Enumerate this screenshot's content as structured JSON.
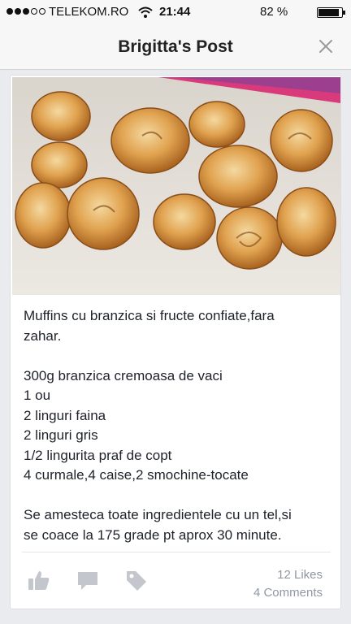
{
  "status_bar": {
    "carrier": "TELEKOM.RO",
    "time": "21:44",
    "battery": "82 %",
    "battery_level": 0.82,
    "icons": [
      "signal-icon",
      "wifi-icon",
      "battery-icon"
    ]
  },
  "nav": {
    "title": "Brigitta's Post",
    "close_icon": "close-icon"
  },
  "post": {
    "photo_icon": "muffins-photo",
    "title_lines": [
      "Muffins cu branzica si fructe confiate,fara",
      "zahar."
    ],
    "ingredients": [
      "300g branzica cremoasa de vaci",
      "1 ou",
      "2 linguri faina",
      "2 linguri gris",
      "1/2 lingurita praf de copt",
      "4 curmale,4 caise,2 smochine-tocate"
    ],
    "instructions_lines": [
      "Se amesteca toate ingredientele cu un tel,si",
      "se coace la 175 grade pt aprox 30 minute."
    ]
  },
  "footer": {
    "likes": "12 Likes",
    "comments": "4 Comments",
    "icon_color": "#c3c6cc",
    "actions": [
      "like-icon",
      "comment-icon",
      "tag-icon"
    ]
  }
}
